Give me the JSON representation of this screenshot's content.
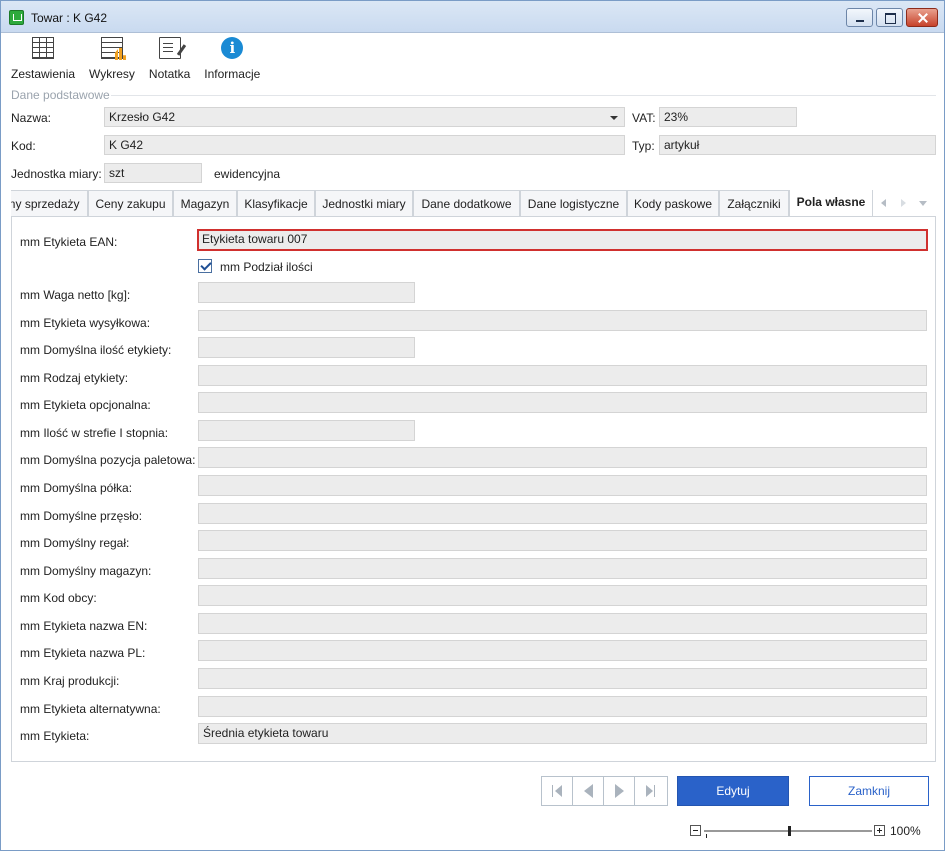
{
  "window": {
    "title": "Towar : K G42"
  },
  "toolbar": {
    "zestawienia": "Zestawienia",
    "wykresy": "Wykresy",
    "notatka": "Notatka",
    "informacje": "Informacje"
  },
  "basic": {
    "section_title": "Dane podstawowe",
    "nazwa_label": "Nazwa:",
    "nazwa_value": "Krzesło G42",
    "vat_label": "VAT:",
    "vat_value": "23%",
    "kod_label": "Kod:",
    "kod_value": "K G42",
    "typ_label": "Typ:",
    "typ_value": "artykuł",
    "jm_label": "Jednostka miary:",
    "jm_value": "szt",
    "jm_suffix": "ewidencyjna"
  },
  "tabs": [
    {
      "label": "Ceny sprzedaży"
    },
    {
      "label": "Ceny zakupu"
    },
    {
      "label": "Magazyn"
    },
    {
      "label": "Klasyfikacje"
    },
    {
      "label": "Jednostki miary"
    },
    {
      "label": "Dane dodatkowe"
    },
    {
      "label": "Dane logistyczne"
    },
    {
      "label": "Kody paskowe"
    },
    {
      "label": "Załączniki"
    },
    {
      "label": "Pola własne"
    }
  ],
  "fields": {
    "ean_label": "mm Etykieta EAN:",
    "ean_value": "Etykieta towaru 007",
    "podzial_label": "mm Podział ilości",
    "rows": [
      {
        "label": "mm Waga netto [kg]:",
        "value": ""
      },
      {
        "label": "mm Etykieta wysyłkowa:",
        "value": ""
      },
      {
        "label": "mm Domyślna ilość etykiety:",
        "value": ""
      },
      {
        "label": "mm Rodzaj etykiety:",
        "value": ""
      },
      {
        "label": "mm Etykieta opcjonalna:",
        "value": ""
      },
      {
        "label": "mm Ilość w strefie I stopnia:",
        "value": ""
      },
      {
        "label": "mm Domyślna pozycja paletowa:",
        "value": ""
      },
      {
        "label": "mm Domyślna półka:",
        "value": ""
      },
      {
        "label": "mm Domyślne przęsło:",
        "value": ""
      },
      {
        "label": "mm Domyślny regał:",
        "value": ""
      },
      {
        "label": "mm Domyślny magazyn:",
        "value": ""
      },
      {
        "label": "mm Kod obcy:",
        "value": ""
      },
      {
        "label": "mm Etykieta nazwa EN:",
        "value": ""
      },
      {
        "label": "mm Etykieta nazwa PL:",
        "value": ""
      },
      {
        "label": "mm Kraj produkcji:",
        "value": ""
      },
      {
        "label": "mm Etykieta alternatywna:",
        "value": ""
      },
      {
        "label": "mm Etykieta:",
        "value": "Średnia etykieta towaru"
      }
    ]
  },
  "buttons": {
    "edytuj": "Edytuj",
    "zamknij": "Zamknij"
  },
  "zoom": {
    "value": "100%"
  },
  "colors": {
    "accent": "#2a62c9",
    "focus_border": "#d0302e",
    "field_bg": "#ececec"
  }
}
